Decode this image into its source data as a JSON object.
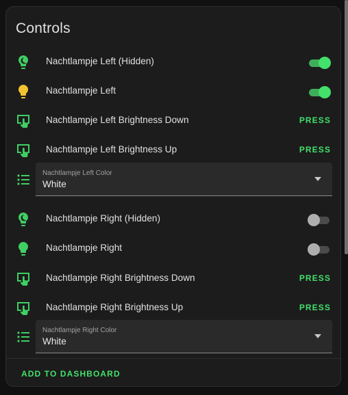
{
  "card": {
    "title": "Controls"
  },
  "colors": {
    "accent": "#43e06b",
    "bulb_yellow": "#f3c230",
    "icon_green": "#3fcf63"
  },
  "rows": [
    {
      "icon": "nightlight-icon",
      "label": "Nachtlampje Left (Hidden)",
      "control": "toggle",
      "state": "on"
    },
    {
      "icon": "lightbulb-icon",
      "label": "Nachtlampje Left",
      "control": "toggle",
      "state": "on"
    },
    {
      "icon": "gesture-tap-button-icon",
      "label": "Nachtlampje Left Brightness Down",
      "control": "button",
      "action": "PRESS"
    },
    {
      "icon": "gesture-tap-button-icon",
      "label": "Nachtlampje Left Brightness Up",
      "control": "button",
      "action": "PRESS"
    },
    {
      "icon": "format-list-bulleted-icon",
      "control": "select",
      "field_label": "Nachtlampje Left Color",
      "value": "White"
    },
    {
      "icon": "nightlight-icon",
      "label": "Nachtlampje Right (Hidden)",
      "control": "toggle",
      "state": "off"
    },
    {
      "icon": "lightbulb-icon",
      "label": "Nachtlampje Right",
      "control": "toggle",
      "state": "off"
    },
    {
      "icon": "gesture-tap-button-icon",
      "label": "Nachtlampje Right Brightness Down",
      "control": "button",
      "action": "PRESS"
    },
    {
      "icon": "gesture-tap-button-icon",
      "label": "Nachtlampje Right Brightness Up",
      "control": "button",
      "action": "PRESS"
    },
    {
      "icon": "format-list-bulleted-icon",
      "control": "select",
      "field_label": "Nachtlampje Right Color",
      "value": "White"
    }
  ],
  "footer": {
    "action_label": "ADD TO DASHBOARD"
  }
}
